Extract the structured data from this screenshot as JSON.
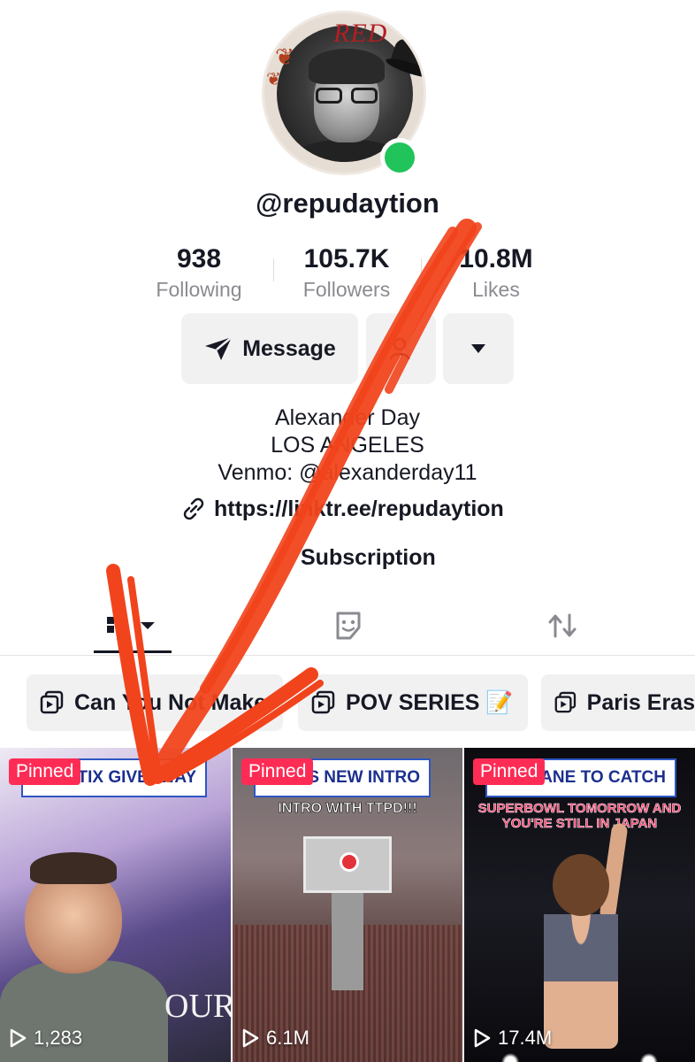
{
  "profile": {
    "avatar_text": "RED",
    "username": "@repudaytion",
    "online": true
  },
  "stats": [
    {
      "value": "938",
      "label": "Following"
    },
    {
      "value": "105.7K",
      "label": "Followers"
    },
    {
      "value": "10.8M",
      "label": "Likes"
    }
  ],
  "actions": {
    "message_label": "Message",
    "message_icon": "send-icon",
    "follow_icon": "user-icon",
    "more_icon": "caret-down-icon"
  },
  "bio": {
    "name_line": "Alexander Day",
    "location_line": "LOS ANGELES",
    "venmo_line": "Venmo: @alexanderday11",
    "link": "https://linktr.ee/repudaytion",
    "subscription_label": "Subscription"
  },
  "tabs": [
    {
      "name": "videos",
      "icon": "grid-icon",
      "active": true
    },
    {
      "name": "favorites",
      "icon": "sticker-icon",
      "active": false
    },
    {
      "name": "reposts",
      "icon": "repost-icon",
      "active": false
    }
  ],
  "playlists": [
    {
      "label": "Can You Not Make",
      "icon": "playlist-icon"
    },
    {
      "label": "POV SERIES 📝",
      "icon": "playlist-icon"
    },
    {
      "label": "Paris Eras",
      "icon": "playlist-icon"
    }
  ],
  "videos": [
    {
      "pinned_label": "Pinned",
      "banner": "TIX GIVEAWAY",
      "caption": "",
      "tour_text": "OUR",
      "views": "1,283"
    },
    {
      "pinned_label": "Pinned",
      "banner": "S NEW INTRO",
      "caption": "INTRO WITH TTPD!!!",
      "views": "6.1M"
    },
    {
      "pinned_label": "Pinned",
      "banner": "LANE TO CATCH",
      "caption": "SUPERBOWL TOMORROW AND YOU'RE STILL IN JAPAN",
      "views": "17.4M"
    }
  ],
  "colors": {
    "accent_pink": "#fe2c55",
    "online_green": "#21c45b",
    "arrow_red": "#f1441c",
    "button_bg": "#f1f1f2",
    "muted_text": "#8a8b91"
  }
}
